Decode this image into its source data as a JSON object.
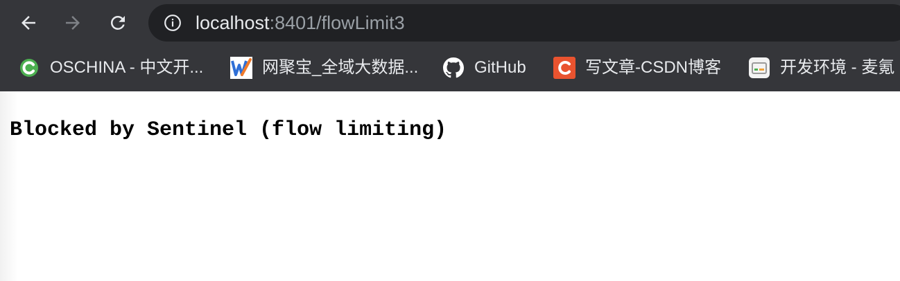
{
  "browser": {
    "address_bar": {
      "host": "localhost",
      "path": ":8401/flowLimit3"
    },
    "nav": {
      "back_icon": "arrow-left-icon",
      "forward_icon": "arrow-right-icon",
      "reload_icon": "reload-icon",
      "info_icon": "info-circle-icon"
    },
    "bookmarks": [
      {
        "label": "OSCHINA - 中文开...",
        "icon": "oschina-icon"
      },
      {
        "label": "网聚宝_全域大数据...",
        "icon": "wangjubao-icon"
      },
      {
        "label": "GitHub",
        "icon": "github-icon"
      },
      {
        "label": "写文章-CSDN博客",
        "icon": "csdn-icon"
      },
      {
        "label": "开发环境 - 麦氪",
        "icon": "maike-icon"
      }
    ],
    "colors": {
      "chrome": "#35363a",
      "omnibox": "#202124",
      "text": "#e8eaed",
      "muted": "#9aa0a6"
    }
  },
  "page": {
    "message": "Blocked by Sentinel (flow limiting)"
  }
}
